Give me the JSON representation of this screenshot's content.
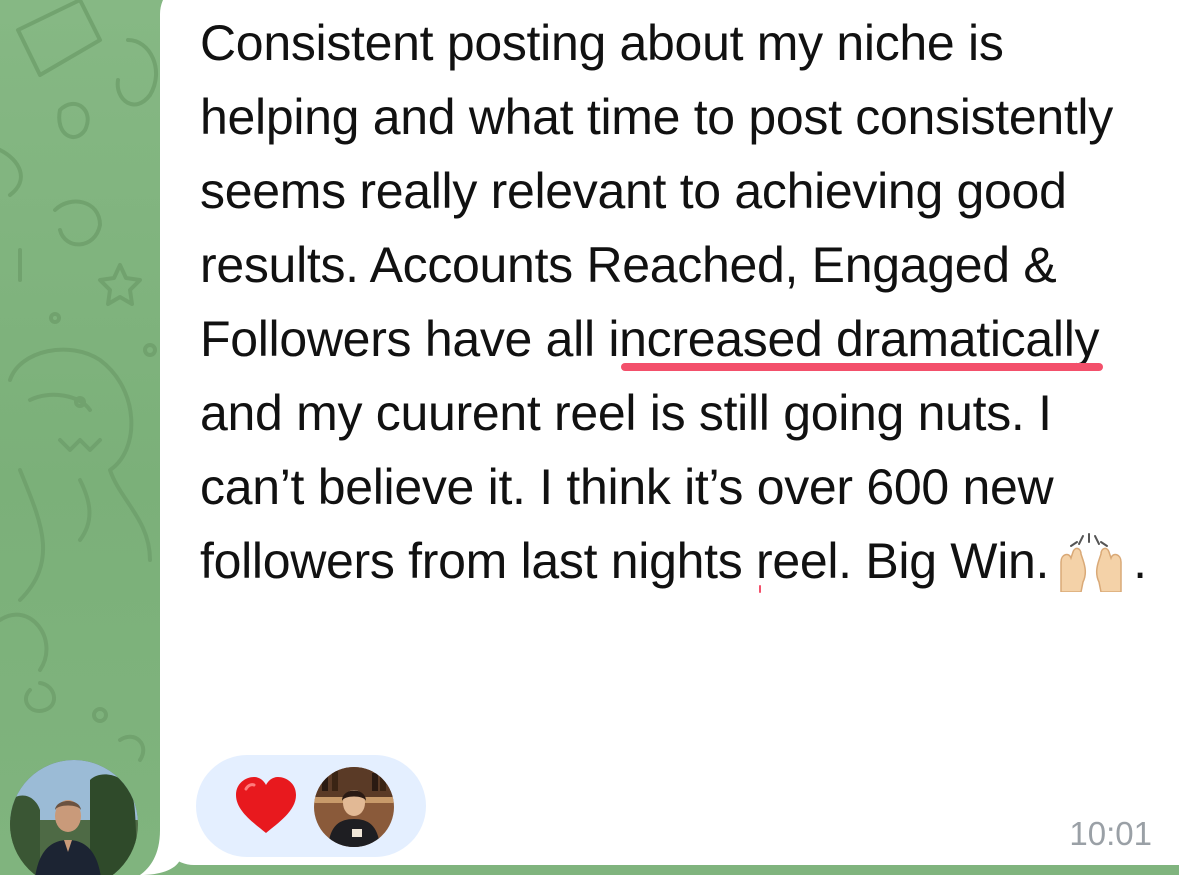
{
  "message": {
    "segments": [
      {
        "text": "Consistent posting about my niche is helping and what time to post consistently seems really relevant to achieving good results. Accounts Reached, Engaged & Followers have all i",
        "highlighted": false
      },
      {
        "text": "ncreased dramatically",
        "highlighted": true
      },
      {
        "text": " and my cuurent reel is still going nuts. I can’t believe it. I think it’s ",
        "highlighted": false
      },
      {
        "text": "over 600 new followers",
        "highlighted": true
      },
      {
        "text": " from last nights reel. Big Win.",
        "highlighted": false
      }
    ],
    "emoji_name": "raising-hands-emoji",
    "trailing_text": ".",
    "time": "10:01"
  },
  "reactions": {
    "emoji_name": "red-heart-icon",
    "reactor_avatar": "reactor-avatar"
  },
  "sender": {
    "avatar": "sender-avatar"
  },
  "colors": {
    "wallpaper": "#7fb27a",
    "bubble": "#ffffff",
    "highlight_underline": "#f3506b",
    "reaction_pill": "#e4efff",
    "heart": "#e8191e",
    "timestamp": "#9aa0a6"
  }
}
